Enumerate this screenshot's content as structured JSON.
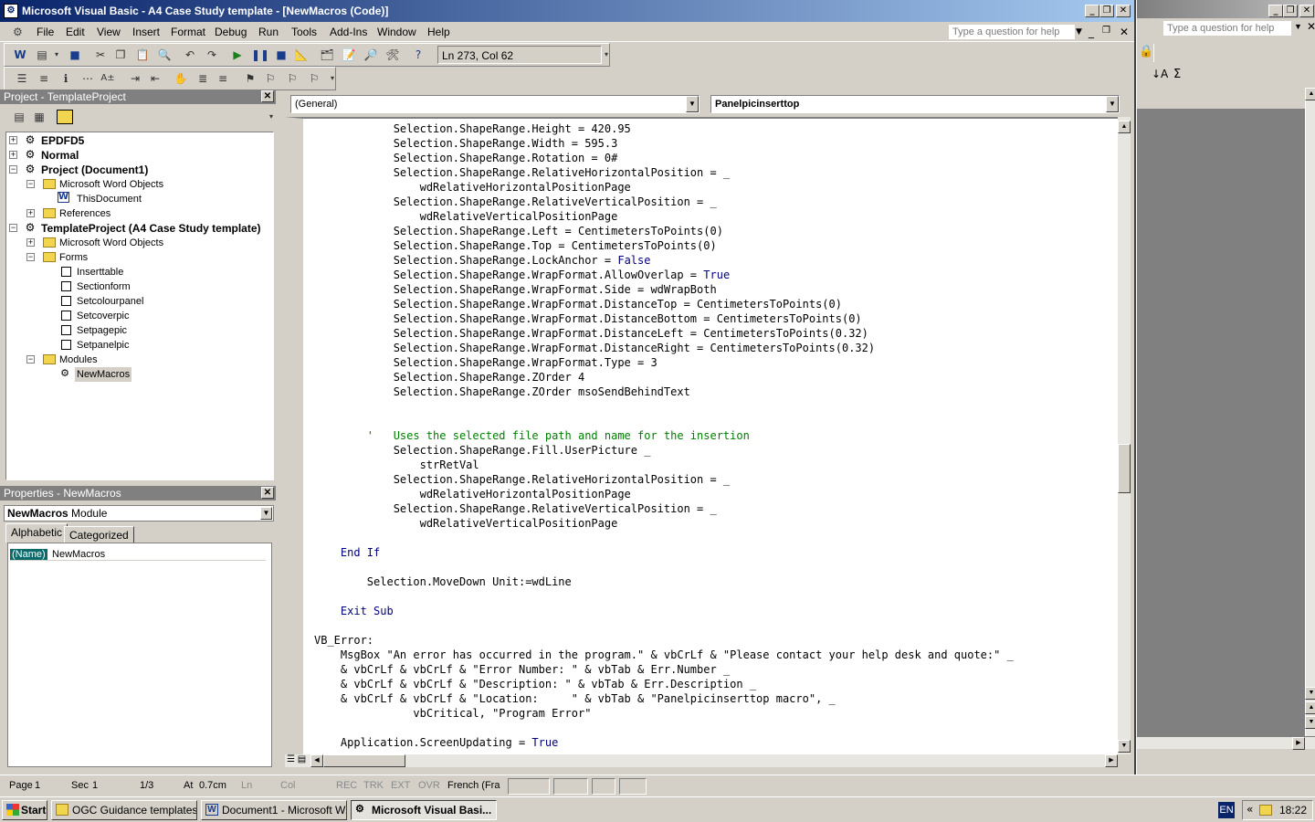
{
  "title": "Microsoft Visual Basic - A4 Case Study template - [NewMacros (Code)]",
  "menu": [
    "File",
    "Edit",
    "View",
    "Insert",
    "Format",
    "Debug",
    "Run",
    "Tools",
    "Add-Ins",
    "Window",
    "Help"
  ],
  "help_placeholder": "Type a question for help",
  "bg_help_placeholder": "Type a question for help",
  "cursor_position": "Ln 273, Col 62",
  "project_panel": {
    "title": "Project - TemplateProject",
    "nodes": [
      {
        "label": "EPDFD5"
      },
      {
        "label": "Normal"
      },
      {
        "label": "Project (Document1)"
      },
      {
        "label": "Microsoft Word Objects"
      },
      {
        "label": "ThisDocument"
      },
      {
        "label": "References"
      },
      {
        "label": "TemplateProject (A4 Case Study template)"
      },
      {
        "label": "Microsoft Word Objects"
      },
      {
        "label": "Forms"
      },
      {
        "label": "Inserttable"
      },
      {
        "label": "Sectionform"
      },
      {
        "label": "Setcolourpanel"
      },
      {
        "label": "Setcoverpic"
      },
      {
        "label": "Setpagepic"
      },
      {
        "label": "Setpanelpic"
      },
      {
        "label": "Modules"
      },
      {
        "label": "NewMacros"
      }
    ]
  },
  "properties_panel": {
    "title": "Properties - NewMacros",
    "object_name": "NewMacros",
    "object_type": "Module",
    "tabs": [
      "Alphabetic",
      "Categorized"
    ],
    "prop_name": "(Name)",
    "prop_value": "NewMacros"
  },
  "code_window": {
    "object_combo": "(General)",
    "proc_combo": "Panelpicinserttop",
    "lines": [
      "            Selection.ShapeRange.Height = 420.95",
      "            Selection.ShapeRange.Width = 595.3",
      "            Selection.ShapeRange.Rotation = 0#",
      "            Selection.ShapeRange.RelativeHorizontalPosition = _",
      "                wdRelativeHorizontalPositionPage",
      "            Selection.ShapeRange.RelativeVerticalPosition = _",
      "                wdRelativeVerticalPositionPage",
      "            Selection.ShapeRange.Left = CentimetersToPoints(0)",
      "            Selection.ShapeRange.Top = CentimetersToPoints(0)",
      "            Selection.ShapeRange.LockAnchor = False",
      "            Selection.ShapeRange.WrapFormat.AllowOverlap = True",
      "            Selection.ShapeRange.WrapFormat.Side = wdWrapBoth",
      "            Selection.ShapeRange.WrapFormat.DistanceTop = CentimetersToPoints(0)",
      "            Selection.ShapeRange.WrapFormat.DistanceBottom = CentimetersToPoints(0)",
      "            Selection.ShapeRange.WrapFormat.DistanceLeft = CentimetersToPoints(0.32)",
      "            Selection.ShapeRange.WrapFormat.DistanceRight = CentimetersToPoints(0.32)",
      "            Selection.ShapeRange.WrapFormat.Type = 3",
      "            Selection.ShapeRange.ZOrder 4",
      "            Selection.ShapeRange.ZOrder msoSendBehindText",
      "",
      "",
      "        '   Uses the selected file path and name for the insertion",
      "            Selection.ShapeRange.Fill.UserPicture _",
      "                strRetVal",
      "            Selection.ShapeRange.RelativeHorizontalPosition = _",
      "                wdRelativeHorizontalPositionPage",
      "            Selection.ShapeRange.RelativeVerticalPosition = _",
      "                wdRelativeVerticalPositionPage",
      "",
      "    End If",
      "",
      "        Selection.MoveDown Unit:=wdLine",
      "",
      "    Exit Sub",
      "",
      "VB_Error:",
      "    MsgBox \"An error has occurred in the program.\" & vbCrLf & \"Please contact your help desk and quote:\" _",
      "    & vbCrLf & vbCrLf & \"Error Number: \" & vbTab & Err.Number _",
      "    & vbCrLf & vbCrLf & \"Description: \" & vbTab & Err.Description _",
      "    & vbCrLf & vbCrLf & \"Location:     \" & vbTab & \"Panelpicinserttop macro\", _",
      "               vbCritical, \"Program Error\"",
      "",
      "    Application.ScreenUpdating = True"
    ]
  },
  "status_bar": {
    "page": "Page",
    "page_num": "1",
    "sec": "Sec",
    "sec_num": "1",
    "pages": "1/3",
    "at": "At",
    "at_val": "0.7cm",
    "ln": "Ln",
    "col": "Col",
    "rec": "REC",
    "trk": "TRK",
    "ext": "EXT",
    "ovr": "OVR",
    "lang": "French (Fra"
  },
  "taskbar": {
    "start": "Start",
    "items": [
      "OGC Guidance templates",
      "Document1 - Microsoft W...",
      "Microsoft Visual Basi..."
    ],
    "lang": "EN",
    "time": "18:22"
  },
  "colors": {
    "keyword": "#00007f",
    "comment": "#007f00",
    "titlebar": "#0a246a"
  }
}
